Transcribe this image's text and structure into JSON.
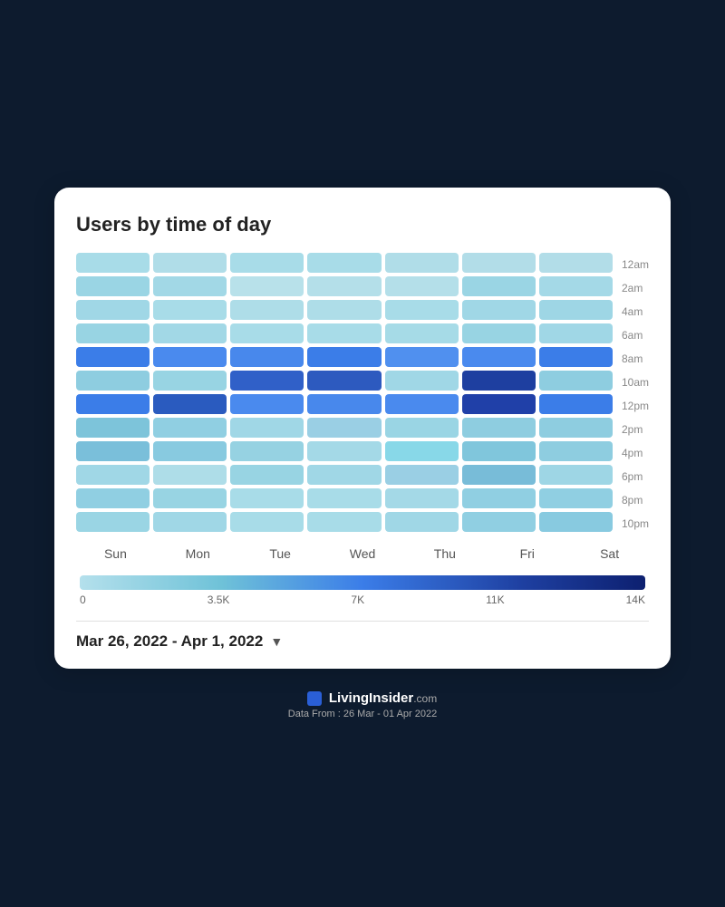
{
  "title": "Users by time of day",
  "y_labels": [
    "12am",
    "2am",
    "4am",
    "6am",
    "8am",
    "10am",
    "12pm",
    "2pm",
    "4pm",
    "6pm",
    "8pm",
    "10pm"
  ],
  "x_labels": [
    "Sun",
    "Mon",
    "Tue",
    "Wed",
    "Thu",
    "Fri",
    "Sat"
  ],
  "legend_labels": [
    "0",
    "3.5K",
    "7K",
    "11K",
    "14K"
  ],
  "date_range": "Mar 26, 2022 - Apr 1, 2022",
  "footer_brand": "LivingInsider",
  "footer_com": ".com",
  "footer_data": "Data From : 26 Mar - 01 Apr 2022",
  "chevron": "▼",
  "grid": [
    [
      "#a8dce8",
      "#b0dde8",
      "#a8dce8",
      "#a8dce8",
      "#b0dde8",
      "#b2dde8",
      "#b2dde8"
    ],
    [
      "#9ad5e4",
      "#a2d8e6",
      "#b8e1ea",
      "#b4dfe9",
      "#b4dfe9",
      "#9ad5e4",
      "#a4d9e7"
    ],
    [
      "#a0d7e6",
      "#a8dce8",
      "#aedde8",
      "#aedde8",
      "#a8dce8",
      "#a0d7e6",
      "#9ed6e5"
    ],
    [
      "#98d4e3",
      "#a2d8e6",
      "#a8dce8",
      "#a8dce8",
      "#a6dbe7",
      "#98d4e3",
      "#a0d7e6"
    ],
    [
      "#3b7de8",
      "#4a8aee",
      "#4888ec",
      "#3b7de8",
      "#5090ef",
      "#4a8aee",
      "#3b7de8"
    ],
    [
      "#8ecde0",
      "#98d4e3",
      "#3060c8",
      "#2d5abf",
      "#a0d7e6",
      "#1e3fa0",
      "#8ecde0"
    ],
    [
      "#3b7de8",
      "#2a5bbf",
      "#4a8aee",
      "#4888ec",
      "#4a8aee",
      "#2040a8",
      "#3b7de8"
    ],
    [
      "#7dc4da",
      "#90cfe2",
      "#a0d7e6",
      "#9acfe4",
      "#9ad5e4",
      "#8ecde0",
      "#8ecde0"
    ],
    [
      "#7abfda",
      "#88cae0",
      "#96d2e2",
      "#a4d9e7",
      "#88d8e8",
      "#80c6dc",
      "#8ecde0"
    ],
    [
      "#a0d7e6",
      "#aedde8",
      "#98d4e3",
      "#a0d7e6",
      "#9acfe4",
      "#78bcd8",
      "#9ed6e5"
    ],
    [
      "#90cfe2",
      "#98d4e3",
      "#a8dce8",
      "#a8dce8",
      "#a4d9e7",
      "#90cfe2",
      "#90cfe2"
    ],
    [
      "#9ad5e4",
      "#a0d7e6",
      "#a8dce8",
      "#a8dce8",
      "#a0d7e6",
      "#90cfe2",
      "#88cae0"
    ]
  ]
}
